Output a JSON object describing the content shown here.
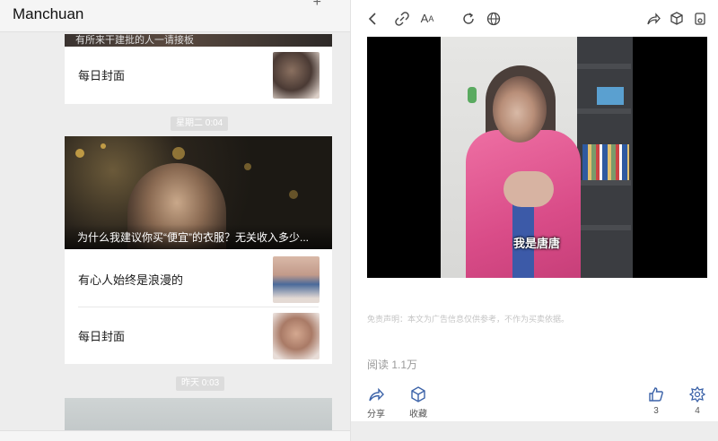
{
  "app": {
    "title": "Manchuan",
    "plus_icon": "plus-icon"
  },
  "feed": {
    "top_card": {
      "banner_caption": "有所来干建批的人一请接板",
      "item_label": "每日封面"
    },
    "group2": {
      "time_label": "星期二 0:04",
      "headline": "为什么我建议你买“便宜”的衣服？无关收入多少...",
      "items": [
        {
          "label": "有心人始终是浪漫的"
        },
        {
          "label": "每日封面"
        }
      ]
    },
    "group3": {
      "time_label": "昨天 0:03"
    }
  },
  "article": {
    "toolbar": {
      "back": "back-icon",
      "link": "link-icon",
      "font": "font-size-icon",
      "refresh": "refresh-icon",
      "browser": "globe-icon",
      "share": "share-icon",
      "box": "cube-icon",
      "more": "pin-icon"
    },
    "video": {
      "subtitle": "我是唐唐"
    },
    "disclaimer": "免责声明：本文为广告信息仅供参考，不作为买卖依据。",
    "reads": "阅读 1.1万",
    "actions": {
      "share_label": "分享",
      "collect_label": "收藏",
      "like_count": "3",
      "wow_count": "4"
    }
  },
  "colors": {
    "accent": "#3b62a8",
    "pink": "#e65a95"
  }
}
